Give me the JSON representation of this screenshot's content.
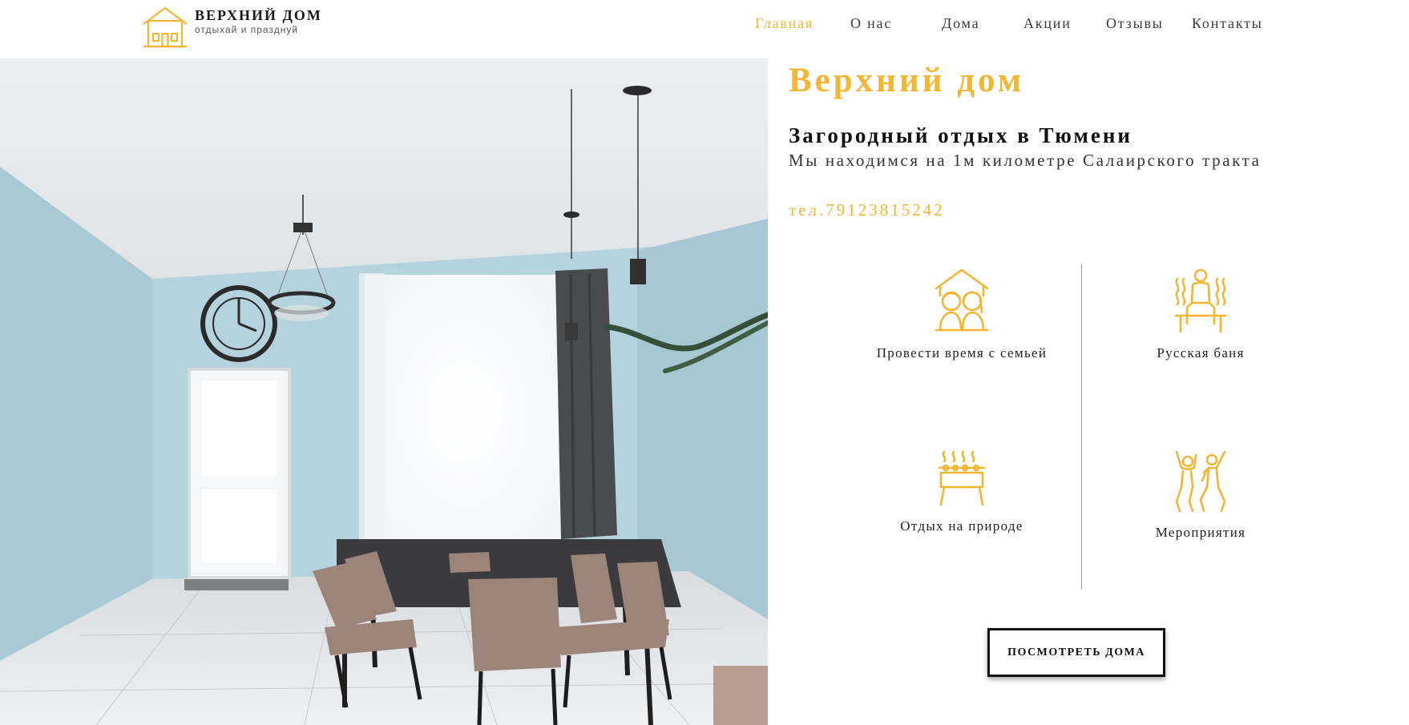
{
  "brand": {
    "name": "ВЕРХНИЙ ДОМ",
    "tagline": "отдыхай и празднуй",
    "accent_color": "#f2b632",
    "logo_icon": "house-icon"
  },
  "nav": {
    "items": [
      {
        "label": "Главная",
        "active": true
      },
      {
        "label": "О нас",
        "active": false
      },
      {
        "label": "Дома",
        "active": false
      },
      {
        "label": "Акции",
        "active": false
      },
      {
        "label": "Отзывы",
        "active": false
      },
      {
        "label": "Контакты",
        "active": false
      }
    ]
  },
  "hero": {
    "title": "Верхний дом",
    "subtitle": "Загородный отдых в Тюмени",
    "address": "Мы находимся на 1м километре Салаирского тракта",
    "phone": "тел.79123815242"
  },
  "features": [
    {
      "label": "Провести время с семьей",
      "icon": "family-house-icon"
    },
    {
      "label": "Русская баня",
      "icon": "sauna-icon"
    },
    {
      "label": "Отдых на природе",
      "icon": "grill-icon"
    },
    {
      "label": "Мероприятия",
      "icon": "party-people-icon"
    }
  ],
  "cta": {
    "label": "ПОСМОТРЕТЬ ДОМА"
  }
}
